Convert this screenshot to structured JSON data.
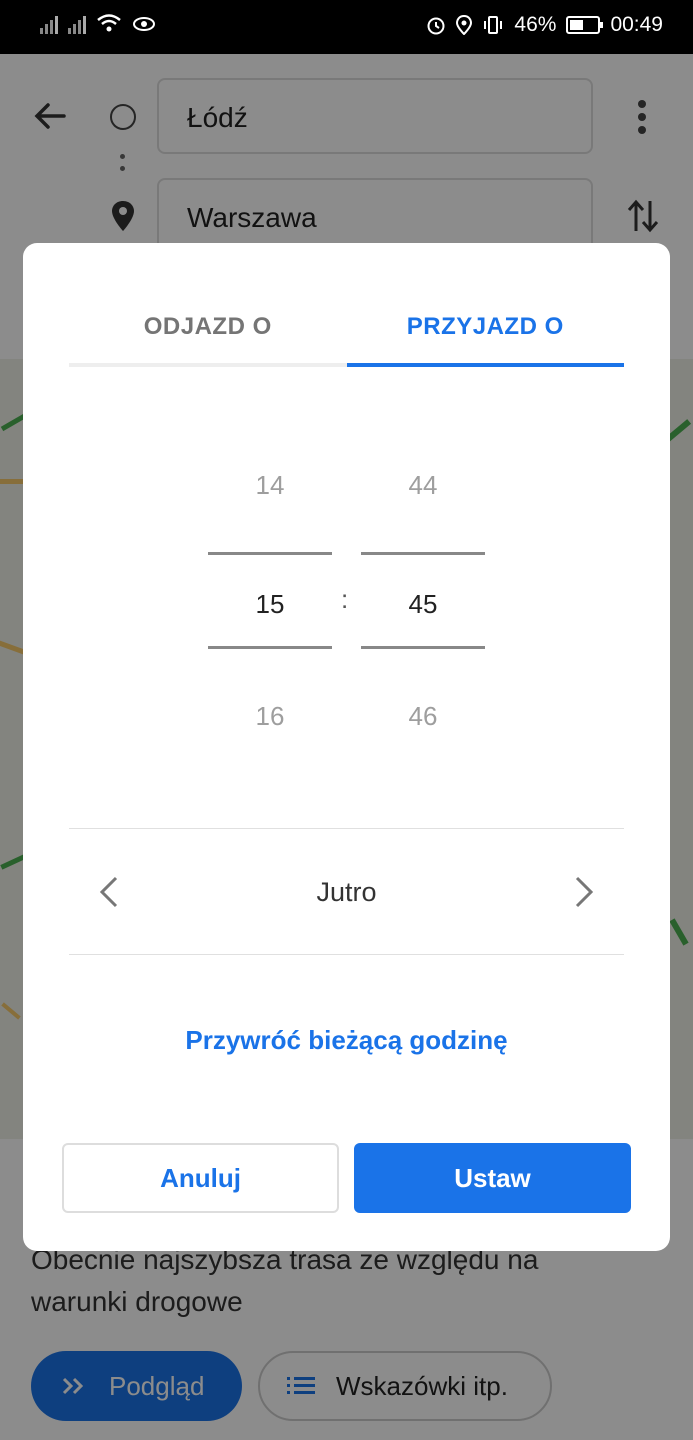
{
  "status_bar": {
    "battery_percent": "46%",
    "time": "00:49"
  },
  "directions": {
    "origin": "Łódź",
    "destination": "Warszawa"
  },
  "bottom_sheet": {
    "route_description": "Obecnie najszybsza trasa ze względu na warunki drogowe",
    "preview_label": "Podgląd",
    "steps_label": "Wskazówki itp."
  },
  "dialog": {
    "tabs": [
      {
        "label": "ODJAZD O",
        "selected": false
      },
      {
        "label": "PRZYJAZD O",
        "selected": true
      }
    ],
    "time_picker": {
      "hours": {
        "prev": "14",
        "current": "15",
        "next": "16"
      },
      "minutes": {
        "prev": "44",
        "current": "45",
        "next": "46"
      },
      "separator": ":"
    },
    "date_label": "Jutro",
    "reset_link": "Przywróć bieżącą godzinę",
    "cancel_label": "Anuluj",
    "set_label": "Ustaw"
  },
  "colors": {
    "accent": "#1a73e8",
    "inactive_tab": "#757575",
    "scrim": "rgba(0,0,0,0.45)"
  },
  "icons": [
    "signal-icon",
    "wifi-icon",
    "eye-icon",
    "alarm-icon",
    "location-icon",
    "vibrate-icon",
    "battery-icon",
    "back-arrow-icon",
    "origin-circle-icon",
    "destination-pin-icon",
    "more-vert-icon",
    "swap-icon",
    "chevron-left-icon",
    "chevron-right-icon",
    "double-chevron-icon",
    "list-icon"
  ]
}
